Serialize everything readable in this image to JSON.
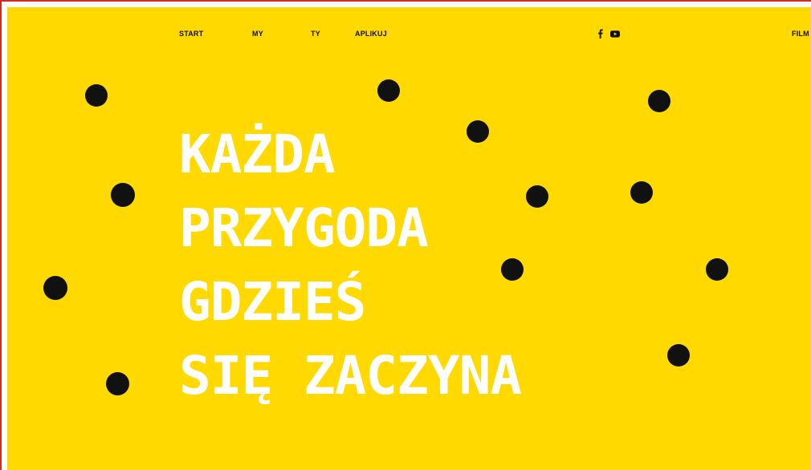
{
  "nav": {
    "start": "START",
    "my": "MY",
    "ty": "TY",
    "aplikuj": "APLIKUJ",
    "film": "FILM"
  },
  "social": {
    "facebook_icon": "facebook-icon",
    "youtube_icon": "youtube-icon"
  },
  "hero": {
    "lines": [
      "KAŻDA",
      "PRZYGODA",
      "GDZIEŚ",
      "SIĘ ZACZYNA"
    ]
  },
  "colors": {
    "background": "#ffd900",
    "text": "#ffffff",
    "dots": "#111111",
    "frame_border": "#d42a1e"
  }
}
